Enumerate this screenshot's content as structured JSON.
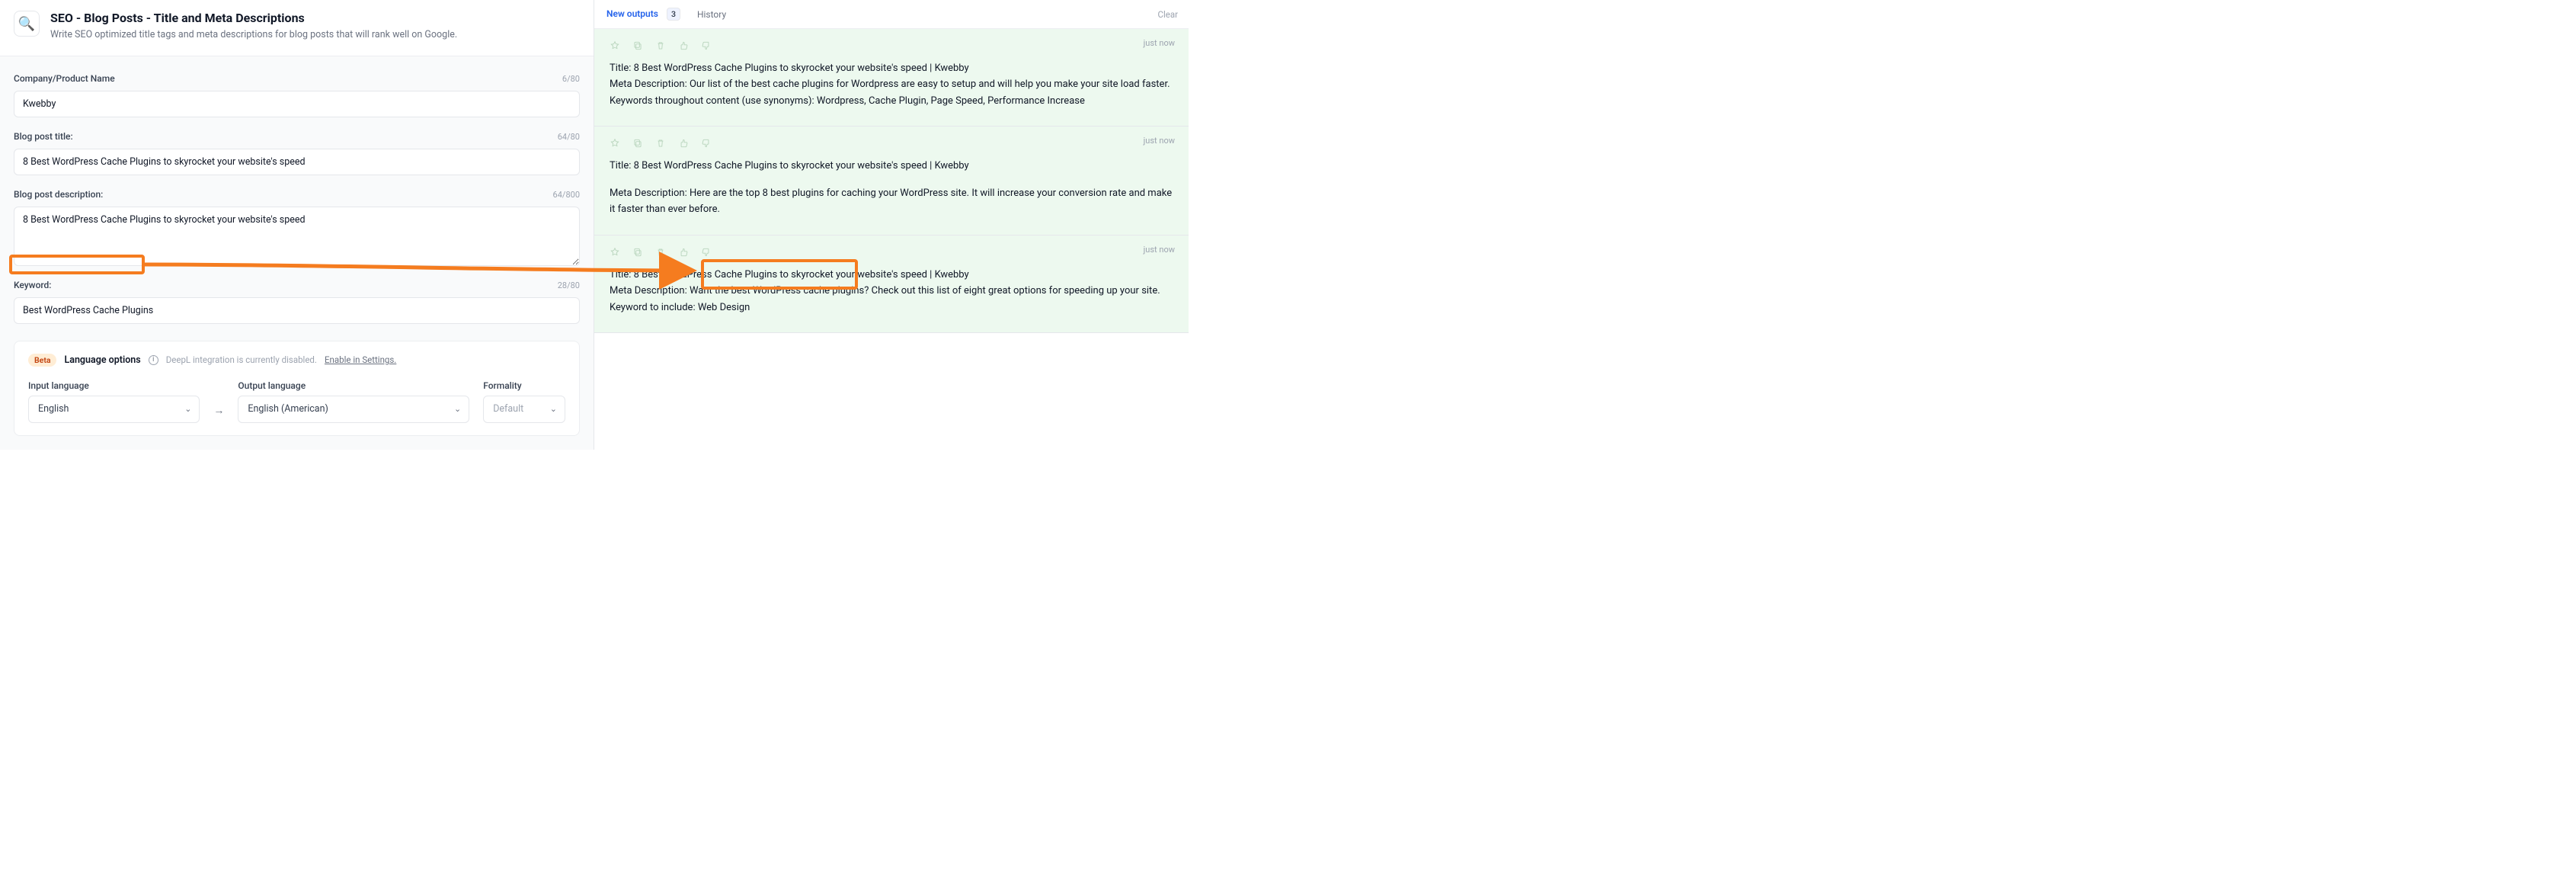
{
  "header": {
    "icon": "🔍",
    "title": "SEO - Blog Posts - Title and Meta Descriptions",
    "subtitle": "Write SEO optimized title tags and meta descriptions for blog posts that will rank well on Google."
  },
  "fields": {
    "company": {
      "label": "Company/Product Name",
      "value": "Kwebby",
      "count": "6/80"
    },
    "blog_title": {
      "label": "Blog post title:",
      "value": "8 Best WordPress Cache Plugins to skyrocket your website's speed",
      "count": "64/80"
    },
    "blog_desc": {
      "label": "Blog post description:",
      "value": "8 Best WordPress Cache Plugins to skyrocket your website's speed",
      "count": "64/800"
    },
    "keyword": {
      "label": "Keyword:",
      "value": "Best WordPress Cache Plugins",
      "count": "28/80"
    }
  },
  "language": {
    "beta": "Beta",
    "title": "Language options",
    "hint": "DeepL integration is currently disabled.",
    "enable_link": "Enable in Settings.",
    "input_label": "Input language",
    "input_value": "English",
    "output_label": "Output language",
    "output_value": "English (American)",
    "formality_label": "Formality",
    "formality_value": "Default"
  },
  "right": {
    "tab_new": "New outputs",
    "tab_new_count": "3",
    "tab_history": "History",
    "clear": "Clear",
    "time": "just now",
    "outputs": [
      {
        "title": "Title: 8 Best WordPress Cache Plugins to skyrocket your website's speed | Kwebby",
        "meta": "Meta Description: Our list of the best cache plugins for Wordpress are easy to setup and will help you make your site load faster.",
        "extra": "Keywords throughout content (use synonyms): Wordpress, Cache Plugin, Page Speed, Performance Increase"
      },
      {
        "title": "Title: 8 Best WordPress Cache Plugins to skyrocket your website's speed | Kwebby",
        "meta": "Meta Description: Here are the top 8 best plugins for caching your WordPress site. It will increase your conversion rate and make it faster than ever before.",
        "extra": ""
      },
      {
        "title": "Title: 8 Best WordPress Cache Plugins to skyrocket your website's speed | Kwebby",
        "meta": "Meta Description: Want the best WordPress cache plugins? Check out this list of eight great options for speeding up your site.",
        "extra": "Keyword to include: Web Design"
      }
    ]
  }
}
